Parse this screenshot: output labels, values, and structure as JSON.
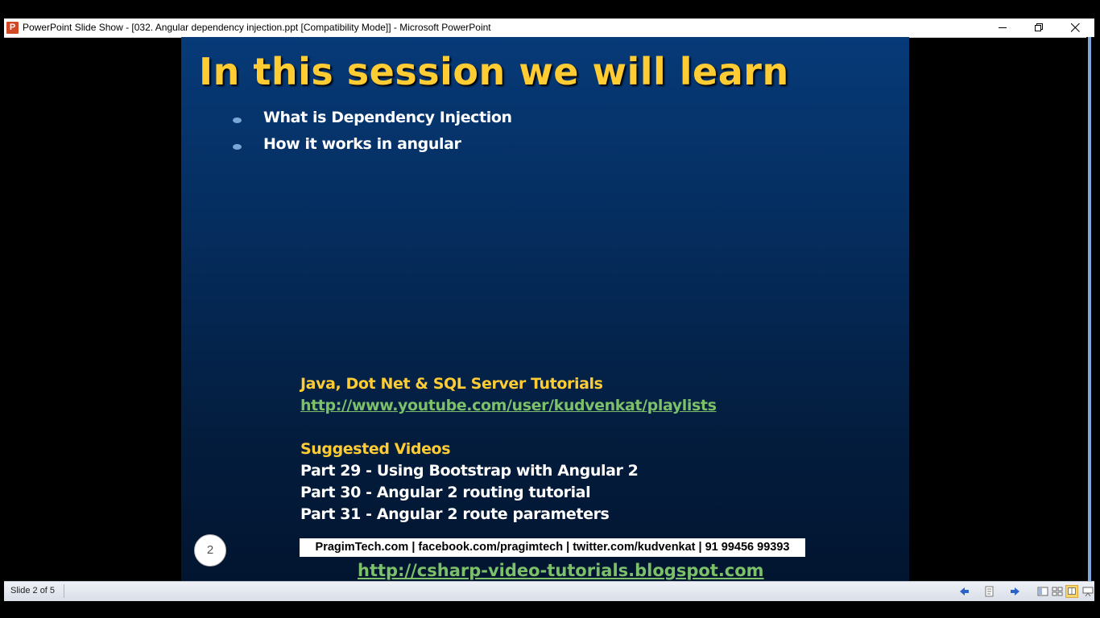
{
  "window": {
    "app_icon_letter": "P",
    "title": "PowerPoint Slide Show - [032. Angular dependency injection.ppt [Compatibility Mode]] - Microsoft PowerPoint"
  },
  "slide": {
    "title": "In this session we will learn",
    "bullets": [
      "What is Dependency Injection",
      "How it works in angular"
    ],
    "tutorials_heading": "Java, Dot Net & SQL Server Tutorials",
    "tutorials_link": "http://www.youtube.com/user/kudvenkat/playlists",
    "suggested_heading": "Suggested Videos",
    "suggested_items": [
      "Part 29 - Using Bootstrap with Angular 2",
      "Part 30 - Angular 2 routing tutorial",
      "Part 31 - Angular 2 route parameters"
    ],
    "slide_number": "2",
    "contact_line": "PragimTech.com | facebook.com/pragimtech | twitter.com/kudvenkat | 91 99456 99393",
    "blog_link": "http://csharp-video-tutorials.blogspot.com"
  },
  "statusbar": {
    "slide_indicator": "Slide 2 of 5"
  },
  "colors": {
    "title_yellow": "#ffcc33",
    "link_green": "#7cc06a",
    "slide_bg_top": "#063a78",
    "slide_bg_bottom": "#021530"
  },
  "icons": [
    "app-icon",
    "minimize-icon",
    "restore-icon",
    "close-icon",
    "previous-slide-icon",
    "menu-icon",
    "next-slide-icon",
    "normal-view-icon",
    "slide-sorter-icon",
    "reading-view-icon",
    "slide-show-icon"
  ]
}
